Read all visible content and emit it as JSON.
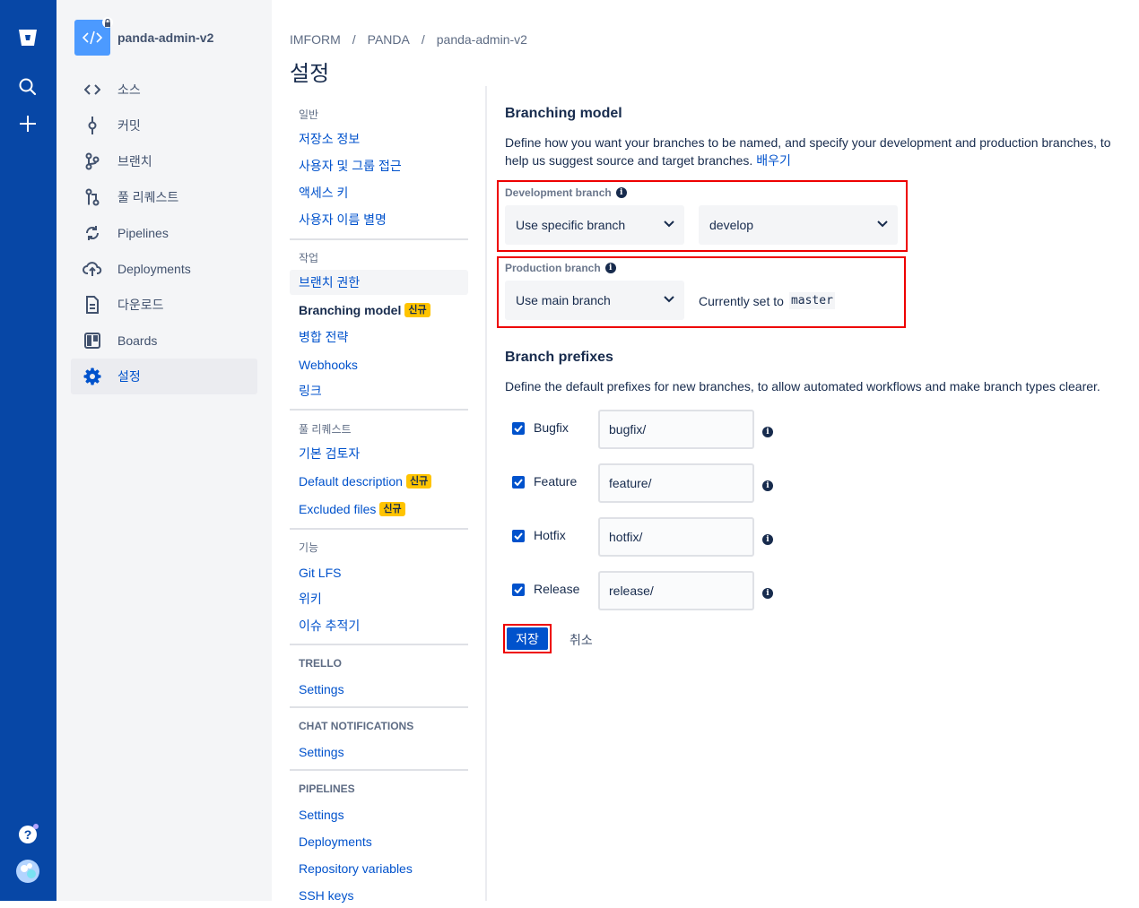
{
  "repo": {
    "name": "panda-admin-v2"
  },
  "sidebar": {
    "items": [
      {
        "label": "소스",
        "icon": "code-icon"
      },
      {
        "label": "커밋",
        "icon": "commit-icon"
      },
      {
        "label": "브랜치",
        "icon": "branch-icon"
      },
      {
        "label": "풀 리퀘스트",
        "icon": "pull-request-icon"
      },
      {
        "label": "Pipelines",
        "icon": "pipelines-icon"
      },
      {
        "label": "Deployments",
        "icon": "deployments-icon"
      },
      {
        "label": "다운로드",
        "icon": "downloads-icon"
      },
      {
        "label": "Boards",
        "icon": "boards-icon"
      },
      {
        "label": "설정",
        "icon": "gear-icon",
        "selected": true
      }
    ]
  },
  "breadcrumb": [
    "IMFORM",
    "PANDA",
    "panda-admin-v2"
  ],
  "breadcrumb_sep": "/",
  "page_title": "설정",
  "settings_nav": {
    "general_head": "일반",
    "general": [
      "저장소 정보",
      "사용자 및 그룹 접근",
      "액세스 키",
      "사용자 이름 별명"
    ],
    "workflow_head": "작업",
    "workflow": {
      "branch_permissions": "브랜치 권한",
      "branching_model": "Branching model",
      "merge_strategy": "병합 전략",
      "webhooks": "Webhooks",
      "links": "링크"
    },
    "new_badge": "신규",
    "pr_head": "풀 리퀘스트",
    "pr": {
      "default_reviewers": "기본 검토자",
      "default_description": "Default description",
      "excluded_files": "Excluded files"
    },
    "features_head": "기능",
    "features": [
      "Git LFS",
      "위키",
      "이슈 추적기"
    ],
    "trello_head": "TRELLO",
    "trello_settings": "Settings",
    "chat_head": "CHAT NOTIFICATIONS",
    "chat_settings": "Settings",
    "pipelines_head": "PIPELINES",
    "pipelines": [
      "Settings",
      "Deployments",
      "Repository variables",
      "SSH keys"
    ]
  },
  "branching": {
    "title": "Branching model",
    "description": "Define how you want your branches to be named, and specify your development and production branches, to help us suggest source and target branches.",
    "learn_link": "배우기",
    "dev_label": "Development branch",
    "dev_mode": "Use specific branch",
    "dev_branch": "develop",
    "prod_label": "Production branch",
    "prod_mode": "Use main branch",
    "currently_text": "Currently set to",
    "main_branch": "master"
  },
  "prefixes": {
    "title": "Branch prefixes",
    "description": "Define the default prefixes for new branches, to allow automated workflows and make branch types clearer.",
    "rows": [
      {
        "label": "Bugfix",
        "value": "bugfix/",
        "checked": true
      },
      {
        "label": "Feature",
        "value": "feature/",
        "checked": true
      },
      {
        "label": "Hotfix",
        "value": "hotfix/",
        "checked": true
      },
      {
        "label": "Release",
        "value": "release/",
        "checked": true
      }
    ]
  },
  "actions": {
    "save": "저장",
    "cancel": "취소"
  },
  "colors": {
    "global_nav": "#0747a6",
    "link": "#0052cc",
    "badge": "#ffc400",
    "highlight": "#e00000"
  }
}
